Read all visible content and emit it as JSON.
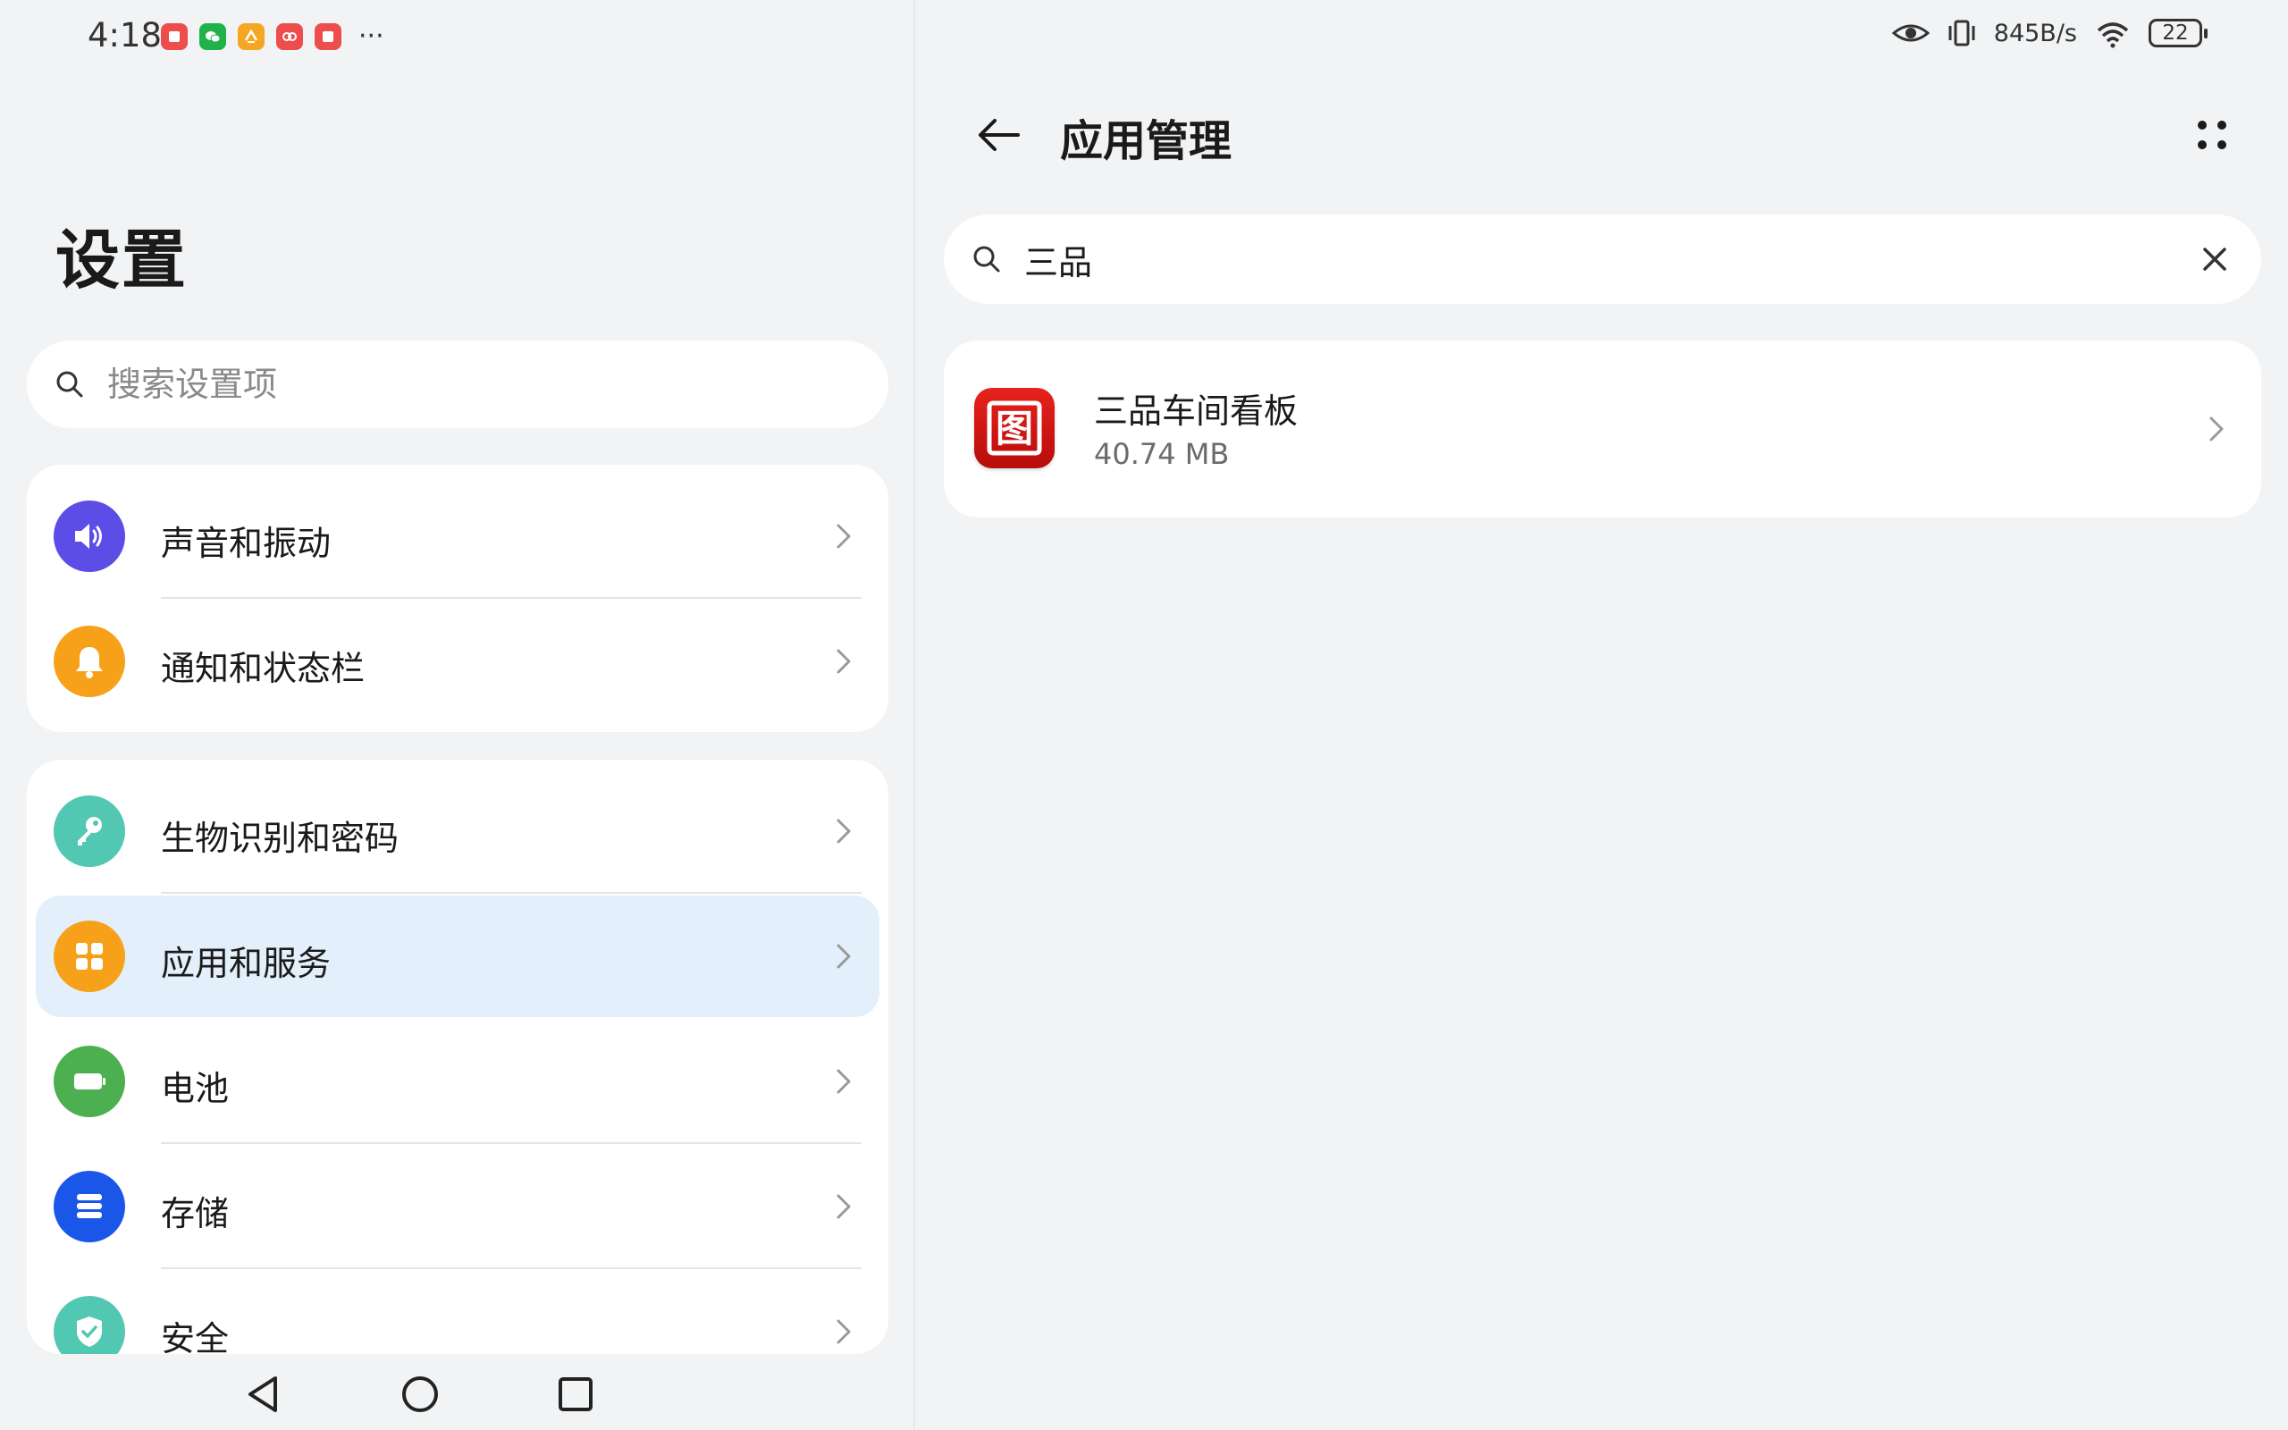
{
  "status_bar": {
    "time": "4:18",
    "notification_icons": [
      "red-app-icon",
      "wechat-icon",
      "orange-app-icon",
      "red-app-icon",
      "red-app-icon"
    ],
    "more": "···",
    "network_speed": "845B/s",
    "battery_level": "22"
  },
  "settings": {
    "title": "设置",
    "search_placeholder": "搜索设置项",
    "group1": [
      {
        "label": "声音和振动",
        "icon": "speaker-icon",
        "color": "#5b4de6"
      },
      {
        "label": "通知和状态栏",
        "icon": "bell-icon",
        "color": "#f7a11a"
      }
    ],
    "group2": [
      {
        "label": "生物识别和密码",
        "icon": "key-icon",
        "color": "#52c7b1"
      },
      {
        "label": "应用和服务",
        "icon": "apps-grid-icon",
        "color": "#f7a11a",
        "selected": true
      },
      {
        "label": "电池",
        "icon": "battery-icon",
        "color": "#4cb050"
      },
      {
        "label": "存储",
        "icon": "storage-icon",
        "color": "#1a56e8"
      },
      {
        "label": "安全",
        "icon": "shield-icon",
        "color": "#52c7b1"
      }
    ]
  },
  "app_management": {
    "title": "应用管理",
    "search_value": "三品",
    "apps": [
      {
        "name": "三品车间看板",
        "size": "40.74 MB",
        "icon_glyph": "图"
      }
    ]
  },
  "colors": {
    "background": "#f1f3f5",
    "selected_item": "#e3effb",
    "app_icon_red": "#d3140f"
  }
}
